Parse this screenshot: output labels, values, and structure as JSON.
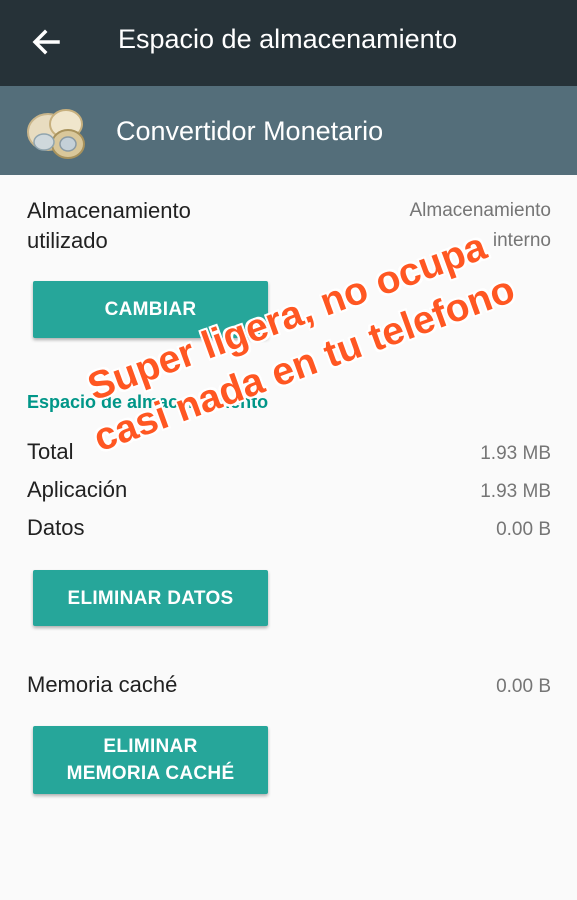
{
  "header": {
    "title": "Espacio de almacenamiento",
    "back_icon": "arrow-left-icon"
  },
  "app": {
    "name": "Convertidor Monetario",
    "icon": "coins-icon"
  },
  "storage_used": {
    "label_line1": "Almacenamiento",
    "label_line2": "utilizado",
    "value_line1": "Almacenamiento",
    "value_line2": "interno",
    "change_button": "CAMBIAR"
  },
  "storage_space": {
    "section_title": "Espacio de almacenamiento",
    "rows": [
      {
        "label": "Total",
        "value": "1.93 MB"
      },
      {
        "label": "Aplicación",
        "value": "1.93 MB"
      },
      {
        "label": "Datos",
        "value": "0.00 B"
      }
    ],
    "clear_data_button": "ELIMINAR DATOS"
  },
  "cache": {
    "label": "Memoria caché",
    "value": "0.00 B",
    "clear_cache_button_line1": "ELIMINAR",
    "clear_cache_button_line2": "MEMORIA CACHÉ"
  },
  "overlay": {
    "line1": "Super ligera, no ocupa",
    "line2": "casi nada en tu telefono"
  },
  "colors": {
    "topbar": "#263238",
    "appbar": "#546e7a",
    "button": "#26a69a",
    "section_accent": "#009688",
    "overlay_text": "#ff5722"
  }
}
